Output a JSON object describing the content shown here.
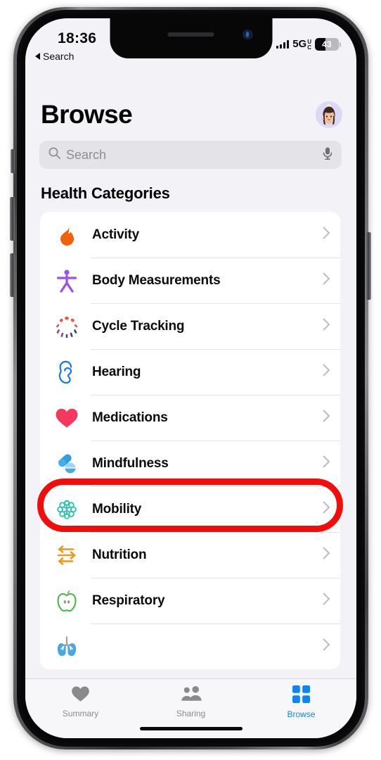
{
  "status_bar": {
    "time": "18:36",
    "network_label": "5G",
    "network_sub_top": "U",
    "network_sub_bottom": "C",
    "battery_percent": "43",
    "battery_level": 43,
    "signal_icon": "cellular-signal-icon"
  },
  "back_link": {
    "label": "Search",
    "icon": "back-caret-icon"
  },
  "header": {
    "title": "Browse",
    "avatar_icon": "memoji-avatar"
  },
  "search": {
    "placeholder": "Search",
    "value": "",
    "search_icon": "search-icon",
    "mic_icon": "microphone-icon"
  },
  "section": {
    "heading": "Health Categories"
  },
  "categories": [
    {
      "label": "Activity",
      "icon": "flame-icon",
      "color": "#f2600c"
    },
    {
      "label": "Body Measurements",
      "icon": "body-figure-icon",
      "color": "#9b4ff0"
    },
    {
      "label": "Cycle Tracking",
      "icon": "cycle-dots-icon",
      "color": "#e8584f"
    },
    {
      "label": "Hearing",
      "icon": "ear-icon",
      "color": "#1877e6"
    },
    {
      "label": "Medications",
      "icon": "pills-icon",
      "color": "#2f9fe0",
      "highlighted": true
    },
    {
      "label": "Mindfulness",
      "icon": "brain-icon",
      "color": "#2ec2b0"
    },
    {
      "label": "Mobility",
      "icon": "arrows-icon",
      "color": "#e89b1c"
    },
    {
      "label": "Nutrition",
      "icon": "apple-icon",
      "color": "#49b84a"
    },
    {
      "label": "Respiratory",
      "icon": "lungs-icon",
      "color": "#4aa8e0"
    }
  ],
  "annotation": {
    "type": "highlight-ring",
    "target": "Medications",
    "color": "#f20d0d"
  },
  "tab_bar": {
    "active": "Browse",
    "active_color": "#1383f2",
    "inactive_color": "#8a8a8e",
    "tabs": [
      {
        "label": "Summary",
        "icon": "heart-icon",
        "active": false
      },
      {
        "label": "Sharing",
        "icon": "people-icon",
        "active": false
      },
      {
        "label": "Browse",
        "icon": "grid-squares-icon",
        "active": true
      }
    ]
  }
}
